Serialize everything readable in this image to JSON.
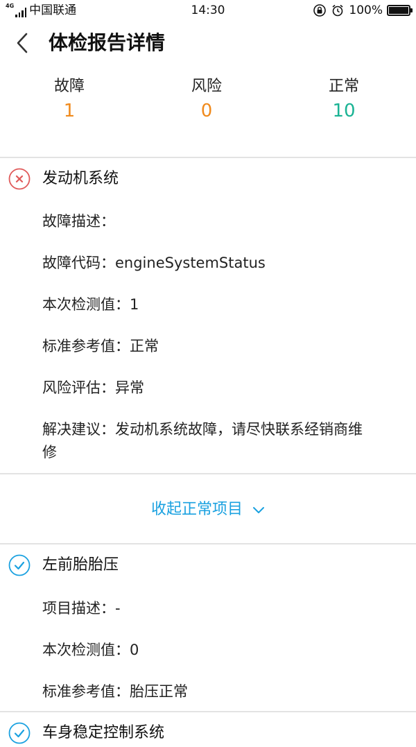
{
  "status_bar": {
    "network": "4G",
    "carrier": "中国联通",
    "time": "14:30",
    "battery": "100%"
  },
  "nav": {
    "title": "体检报告详情"
  },
  "summary": {
    "fault_label": "故障",
    "fault_value": "1",
    "risk_label": "风险",
    "risk_value": "0",
    "normal_label": "正常",
    "normal_value": "10",
    "colors": {
      "fault": "#f08a1c",
      "risk": "#f08a1c",
      "normal": "#1ab394"
    }
  },
  "fault_item": {
    "title": "发动机系统",
    "status": "fault",
    "rows": [
      "故障描述：",
      "故障代码：engineSystemStatus",
      "本次检测值：1",
      "标准参考值：正常",
      "风险评估：异常",
      "解决建议：发动机系统故障，请尽快联系经销商维修"
    ]
  },
  "collapse": {
    "label": "收起正常项目"
  },
  "normal_items": [
    {
      "title": "左前胎胎压",
      "status": "normal",
      "rows": [
        "项目描述：-",
        "本次检测值：0",
        "标准参考值：胎压正常"
      ]
    },
    {
      "title": "车身稳定控制系统",
      "status": "normal"
    }
  ],
  "colors": {
    "fault_icon": "#e05a5a",
    "ok_icon": "#1aa1e0",
    "link": "#1aa1e0"
  }
}
